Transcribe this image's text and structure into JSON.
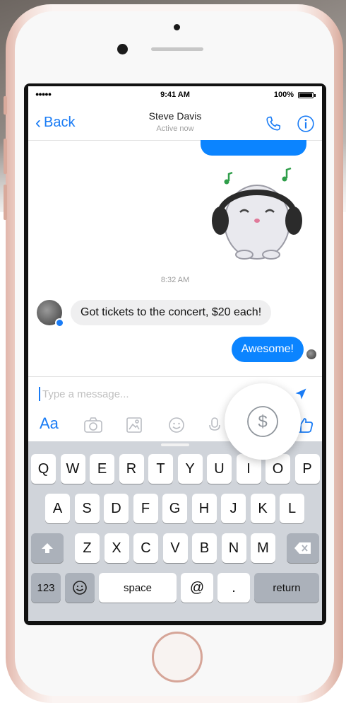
{
  "status_bar": {
    "signal": "●●●●● ",
    "time": "9:41 AM",
    "battery": "100%"
  },
  "nav": {
    "back_label": "Back",
    "contact_name": "Steve Davis",
    "contact_status": "Active now"
  },
  "conversation": {
    "timestamp": "8:32 AM",
    "incoming_message": "Got tickets to the concert, $20 each!",
    "outgoing_message": "Awesome!"
  },
  "composer": {
    "placeholder": "Type a message..."
  },
  "toolbar": {
    "aa_label": "Aa"
  },
  "keyboard": {
    "row1": [
      "Q",
      "W",
      "E",
      "R",
      "T",
      "Y",
      "U",
      "I",
      "O",
      "P"
    ],
    "row2": [
      "A",
      "S",
      "D",
      "F",
      "G",
      "H",
      "J",
      "K",
      "L"
    ],
    "row3": [
      "Z",
      "X",
      "C",
      "V",
      "B",
      "N",
      "M"
    ],
    "numbers_label": "123",
    "space_label": "space",
    "at_label": "@",
    "period_label": ".",
    "return_label": "return"
  },
  "colors": {
    "accent": "#1a7cf5",
    "outgoing_bubble": "#0b84ff",
    "incoming_bubble": "#efeff0",
    "keyboard_bg": "#d0d4da"
  }
}
